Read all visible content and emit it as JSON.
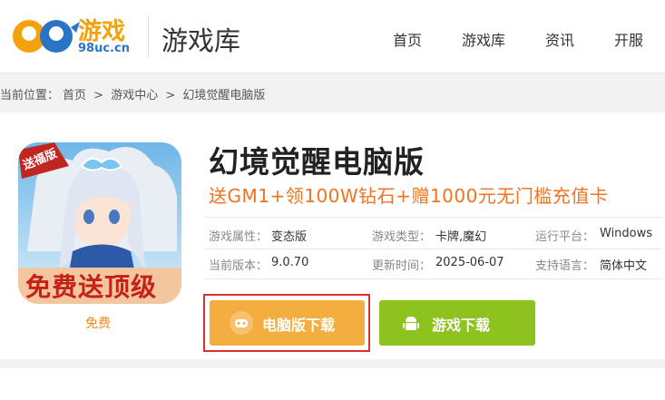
{
  "header": {
    "logo_text": "游戏",
    "logo_domain": "98uc.cn",
    "site_title": "游戏库",
    "nav": [
      "首页",
      "游戏库",
      "资讯",
      "开服"
    ]
  },
  "breadcrumb": {
    "label": "当前位置：",
    "items": [
      "首页",
      "游戏中心",
      "幻境觉醒电脑版"
    ],
    "separator": ">"
  },
  "game": {
    "icon_badge": "送福版",
    "icon_banner": "免费送顶级",
    "price": "免费",
    "title": "幻境觉醒电脑版",
    "promo": "送GM1+领100W钻石+赠1000元无门槛充值卡",
    "info": [
      {
        "label": "游戏属性：",
        "value": "变态版"
      },
      {
        "label": "游戏类型：",
        "value": "卡牌,魔幻"
      },
      {
        "label": "运行平台：",
        "value": "Windows"
      },
      {
        "label": "当前版本：",
        "value": "9.0.70"
      },
      {
        "label": "更新时间：",
        "value": "2025-06-07"
      },
      {
        "label": "支持语言：",
        "value": "简体中文"
      }
    ]
  },
  "buttons": {
    "pc_download": "电脑版下载",
    "game_download": "游戏下载"
  },
  "colors": {
    "orange": "#f4ae3f",
    "green": "#8dc21f",
    "promo": "#f2731c",
    "highlight": "#d9312f"
  }
}
